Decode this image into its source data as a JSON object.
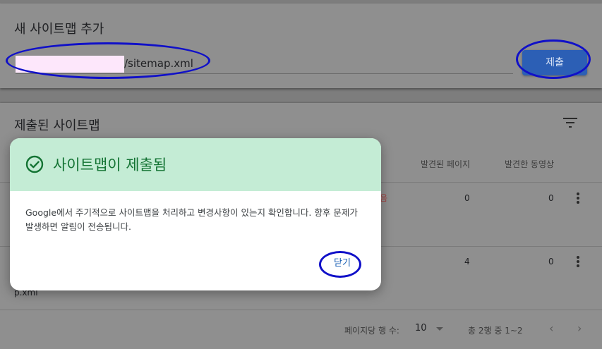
{
  "add_sitemap": {
    "title": "새 사이트맵 추가",
    "url_value": "/sitemap.xml",
    "submit_label": "제출"
  },
  "submitted": {
    "title": "제출된 사이트맵",
    "columns": {
      "discovered_pages": "발견된 페이지",
      "discovered_videos": "발견한 동영상"
    },
    "rows": [
      {
        "status_fragment": "음",
        "pages": "0",
        "videos": "0"
      },
      {
        "name_fragment": "p.xml",
        "pages": "4",
        "videos": "0"
      }
    ],
    "footer": {
      "rows_per_page_label": "페이지당 행 수:",
      "rows_per_page_value": "10",
      "range": "총 2행 중 1~2",
      "prev": "‹",
      "next": "›"
    }
  },
  "dialog": {
    "title": "사이트맵이 제출됨",
    "body": "Google에서 주기적으로 사이트맵을 처리하고 변경사항이 있는지 확인합니다. 향후 문제가 발생하면 알림이 전송됩니다.",
    "close_label": "닫기"
  },
  "colors": {
    "accent": "#2c5fb5",
    "success": "#137333",
    "annotation": "#1010c8"
  }
}
